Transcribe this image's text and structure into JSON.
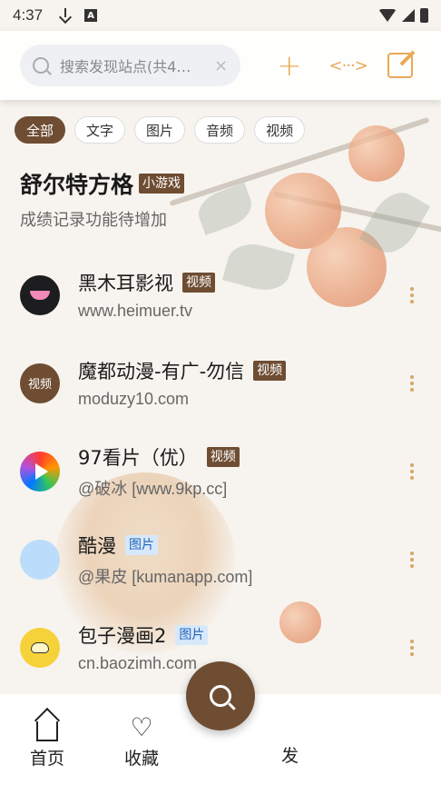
{
  "status_bar": {
    "time": "4:37",
    "a_label": "A"
  },
  "search": {
    "placeholder": "搜索发现站点(共4…",
    "clear": "×"
  },
  "header_actions": {
    "plus": "+",
    "code": "<···>"
  },
  "filters": [
    {
      "label": "全部",
      "active": true
    },
    {
      "label": "文字",
      "active": false
    },
    {
      "label": "图片",
      "active": false
    },
    {
      "label": "音频",
      "active": false
    },
    {
      "label": "视频",
      "active": false
    }
  ],
  "group": {
    "name": "舒尔特方格",
    "tag": "小游戏",
    "subtitle": "成绩记录功能待增加"
  },
  "sites": [
    {
      "title": "黑木耳影视",
      "tag": "视频",
      "tag_style": "brown",
      "url": "www.heimuer.tv",
      "avatar": "heimuer"
    },
    {
      "title": "魔都动漫-有广-勿信",
      "tag": "视频",
      "tag_style": "brown",
      "url": "moduzy10.com",
      "avatar": "moduzy",
      "avatar_text": "视频"
    },
    {
      "title": "97看片（优）",
      "tag": "视频",
      "tag_style": "brown",
      "url": "@破冰 [www.9kp.cc]",
      "avatar": "97"
    },
    {
      "title": "酷漫",
      "tag": "图片",
      "tag_style": "blue",
      "url": "@果皮 [kumanapp.com]",
      "avatar": "kuman"
    },
    {
      "title": "包子漫画2",
      "tag": "图片",
      "tag_style": "blue",
      "url": "cn.baozimh.com",
      "avatar": "baozi"
    }
  ],
  "bottom_nav": {
    "home": "首页",
    "favorites": "收藏",
    "discover_partial": "发"
  },
  "colors": {
    "accent": "#e9a957",
    "brand_brown": "#6e4d33",
    "tag_blue_bg": "#d7e8fb"
  }
}
